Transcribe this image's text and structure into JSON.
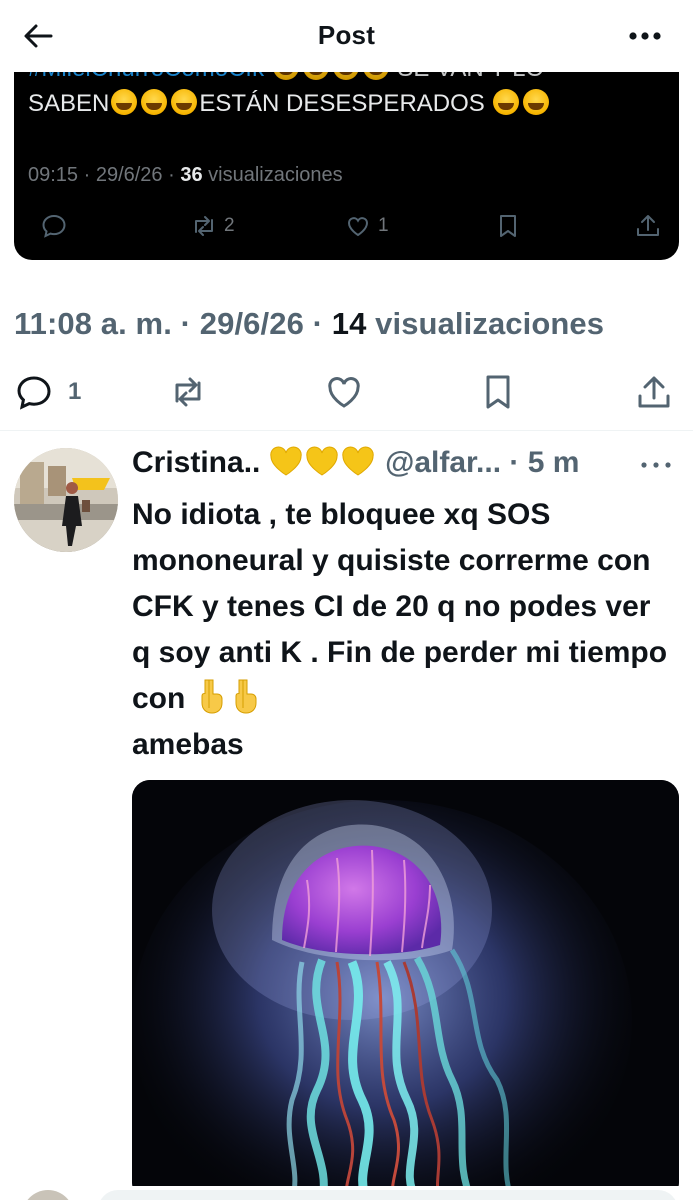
{
  "header": {
    "title": "Post",
    "back_icon": "arrow-left-icon",
    "more_icon": "more-horizontal-icon"
  },
  "quoted_post": {
    "cut_text": "#MileiChurroComoCfk",
    "cut_text_tail": "SE VAN Y LO",
    "text_prefix": "SABEN",
    "text_middle": "ESTÁN DESESPERADOS",
    "time": "09:15 · 29/6/26 · ",
    "views_count": "36",
    "views_label": " visualizaciones",
    "reply_count": "",
    "retweet_count": "2",
    "like_count": "1"
  },
  "post_meta": {
    "time": "11:08 a. m. · 29/6/26 · ",
    "views_count": "14",
    "views_label": " visualizaciones"
  },
  "post_actions": {
    "reply_count": "1"
  },
  "reply": {
    "name": "Cristina..",
    "handle": "@alfar...",
    "time": " · 5 m",
    "text_main": "No idiota , te bloquee xq SOS mononeural y quisiste correrme con CFK y tenes CI de 20 q no podes  ver q soy anti K . Fin de perder mi tiempo con ",
    "text_end": "amebas"
  },
  "colors": {
    "accent": "#1d9bf0",
    "secondary_text": "#536471",
    "dark_card": "#000000",
    "heart_emoji": "#f5c518"
  }
}
